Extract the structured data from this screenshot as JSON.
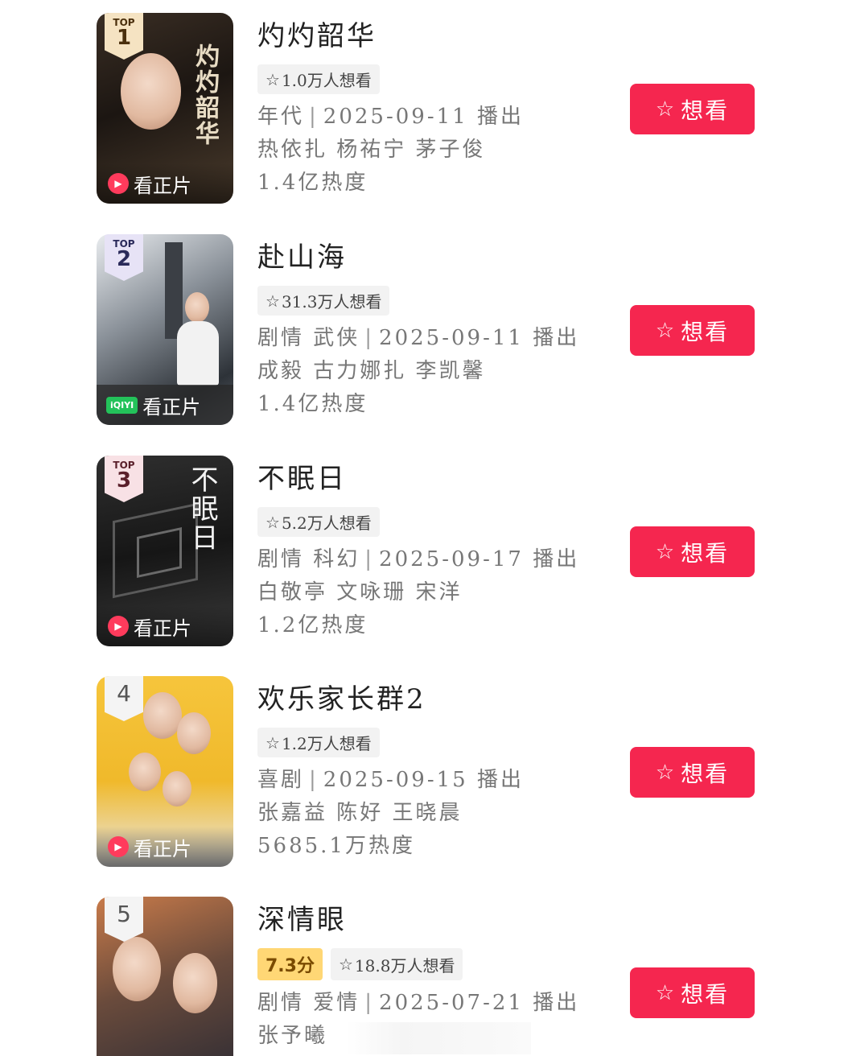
{
  "items": [
    {
      "rank_top": "TOP",
      "rank": "1",
      "poster_title": "灼灼韶华",
      "play_label": "看正片",
      "title": "灼灼韶华",
      "want": "1.0万人想看",
      "genres": "年代",
      "date": "2025-09-11",
      "air_label": "播出",
      "cast": "热依扎  杨祐宁  茅子俊",
      "heat": "1.4亿热度",
      "button": "想看"
    },
    {
      "rank_top": "TOP",
      "rank": "2",
      "platform": "iQIYI",
      "play_label": "看正片",
      "title": "赴山海",
      "want": "31.3万人想看",
      "genres": "剧情  武侠",
      "date": "2025-09-11",
      "air_label": "播出",
      "cast": "成毅  古力娜扎  李凯馨",
      "heat": "1.4亿热度",
      "button": "想看"
    },
    {
      "rank_top": "TOP",
      "rank": "3",
      "poster_title": "不眠日",
      "play_label": "看正片",
      "title": "不眠日",
      "want": "5.2万人想看",
      "genres": "剧情  科幻",
      "date": "2025-09-17",
      "air_label": "播出",
      "cast": "白敬亭  文咏珊  宋洋",
      "heat": "1.2亿热度",
      "button": "想看"
    },
    {
      "rank": "4",
      "play_label": "看正片",
      "title": "欢乐家长群2",
      "want": "1.2万人想看",
      "genres": "喜剧",
      "date": "2025-09-15",
      "air_label": "播出",
      "cast": "张嘉益  陈好  王晓晨",
      "heat": "5685.1万热度",
      "button": "想看"
    },
    {
      "rank": "5",
      "title": "深情眼",
      "score": "7.3分",
      "want": "18.8万人想看",
      "genres": "剧情  爱情",
      "date": "2025-07-21",
      "air_label": "播出",
      "cast": "张予曦",
      "button": "想看"
    }
  ],
  "icons": {
    "star": "star-outline-icon",
    "play": "play-circle-icon"
  },
  "colors": {
    "accent": "#f5264f",
    "score_bg": "#ffd775"
  }
}
